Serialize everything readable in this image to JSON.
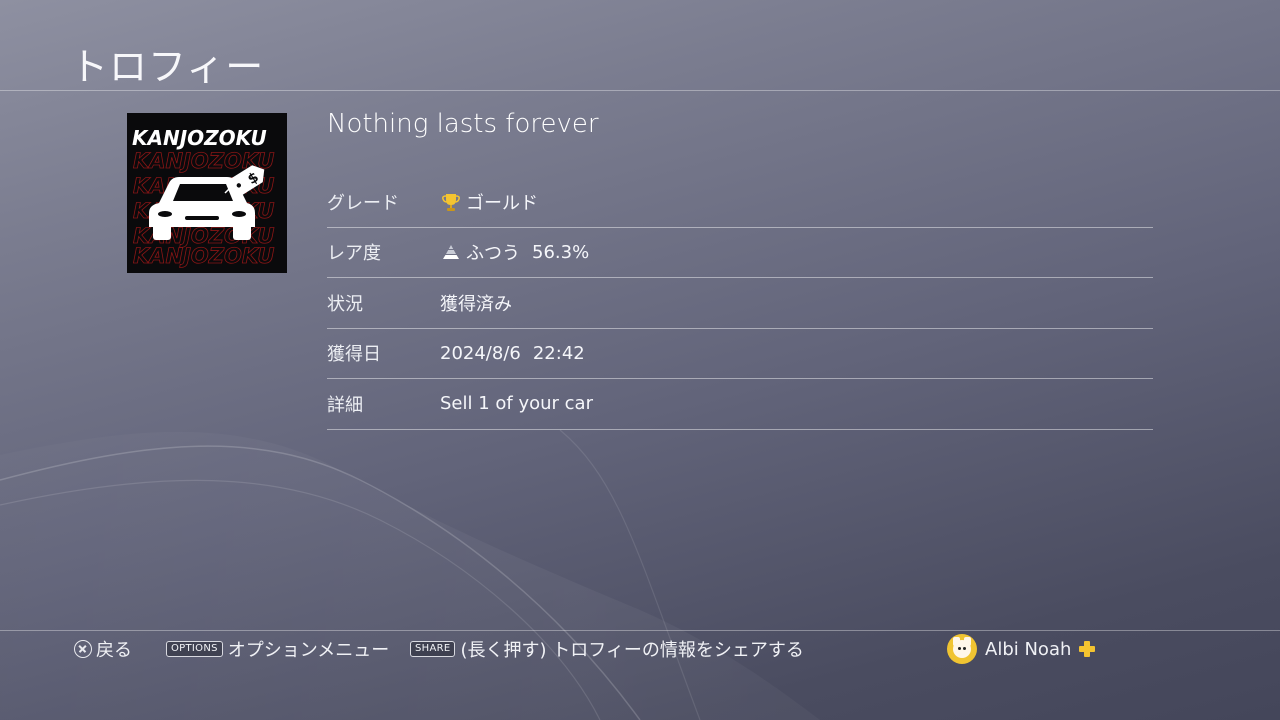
{
  "screen": {
    "title": "トロフィー"
  },
  "trophy": {
    "name": "Nothing lasts forever",
    "art": {
      "brand": "KANJOZOKU",
      "tag_symbol": "$",
      "colors": {
        "background": "#0a0a0c",
        "accent_text": "#8c1616",
        "car": "#ffffff"
      }
    },
    "rows": [
      {
        "label": "グレード",
        "value": "ゴールド",
        "icon": "gold-trophy-icon"
      },
      {
        "label": "レア度",
        "value": "ふつう",
        "value_extra": "56.3%",
        "icon": "rarity-pyramid-icon"
      },
      {
        "label": "状況",
        "value": "獲得済み"
      },
      {
        "label": "獲得日",
        "value": "2024/8/6",
        "value_extra": "22:42"
      },
      {
        "label": "詳細",
        "value": "Sell 1 of your car"
      }
    ]
  },
  "footer": {
    "back": {
      "icon": "cross-button-icon",
      "label": "戻る"
    },
    "options": {
      "key": "OPTIONS",
      "label": "オプションメニュー"
    },
    "share": {
      "key": "SHARE",
      "label": "(長く押す) トロフィーの情報をシェアする"
    },
    "user": {
      "name": "Albi Noah",
      "avatar": "avatar-icon",
      "badge": "ps-plus-icon"
    }
  },
  "colors": {
    "gold": "#f4c430",
    "text": "#f5f6fa"
  }
}
